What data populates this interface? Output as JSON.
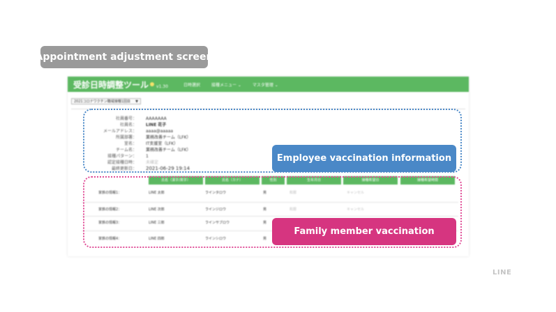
{
  "slide_tag": "Appointment adjustment screen",
  "app": {
    "title": "受診日時調整ツール",
    "version": "v1.30",
    "menu": [
      "日時選択",
      "接種メニュー ⌄",
      "マスタ管理 ⌄"
    ],
    "select_value": "2021コロナワクチン職域接種1回目"
  },
  "employee": {
    "rows": [
      {
        "label": "社員番号：",
        "value": "AAAAAAA"
      },
      {
        "label": "社員名：",
        "value": "LINE 花子"
      },
      {
        "label": "メールアドレス：",
        "value": "aaaa@aaaaa"
      },
      {
        "label": "所属部署：",
        "value": "業務改善チーム（LFK）"
      },
      {
        "label": "室名：",
        "value": "IT支援室（LFK）"
      },
      {
        "label": "チーム名：",
        "value": "業務改善チーム（LFK）"
      },
      {
        "label": "接種パターン：",
        "value": "1"
      },
      {
        "label": "認定接種日時：",
        "value": "未確定"
      },
      {
        "label": "最終更新日：",
        "value": "2021-06-29 19:14"
      }
    ]
  },
  "family": {
    "headers": [
      "氏名（漢字/英字）",
      "氏名（カナ）",
      "性別",
      "生年月日",
      "接種希望日",
      "接種希望時間"
    ],
    "rows": [
      {
        "label": "家族の情報1：",
        "name": "LINE 太郎",
        "kana": "ラインタロウ",
        "gender": "男",
        "dob": "和暦",
        "status": "キャンセル"
      },
      {
        "label": "家族の情報2：",
        "name": "LINE 次郎",
        "kana": "ラインジロウ",
        "gender": "男",
        "dob": "和暦",
        "status": "キャンセル"
      },
      {
        "label": "家族の情報3：",
        "name": "LINE 三郎",
        "kana": "ラインサブロウ",
        "gender": "男",
        "dob": "",
        "status": ""
      },
      {
        "label": "家族の情報4：",
        "name": "LINE 四郎",
        "kana": "ラインシロウ",
        "gender": "男",
        "dob": "",
        "status": ""
      }
    ]
  },
  "callouts": {
    "employee": "Employee vaccination information",
    "family": "Family member vaccination"
  },
  "brand": "LINE",
  "colors": {
    "header_green": "#5cb861",
    "employee_blue": "#4a88c7",
    "family_pink": "#d63580",
    "tag_gray": "#9a9a9a"
  }
}
